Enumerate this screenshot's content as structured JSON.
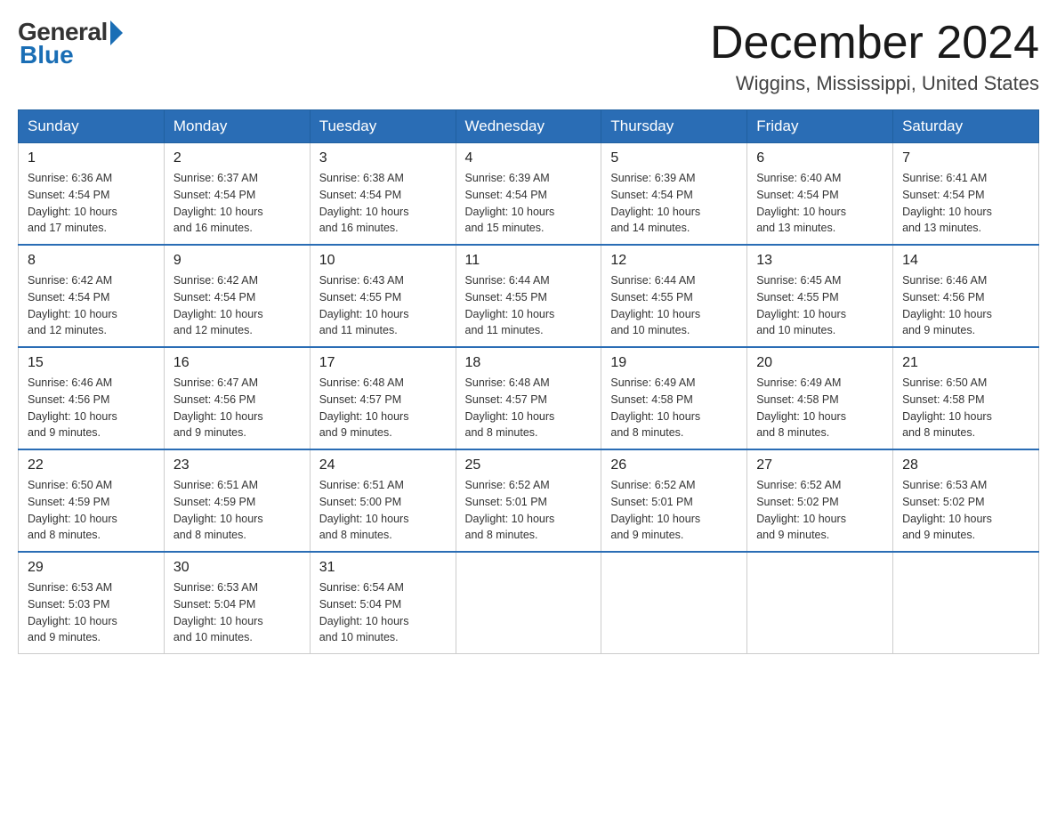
{
  "logo": {
    "general": "General",
    "blue": "Blue"
  },
  "header": {
    "title": "December 2024",
    "location": "Wiggins, Mississippi, United States"
  },
  "weekdays": [
    "Sunday",
    "Monday",
    "Tuesday",
    "Wednesday",
    "Thursday",
    "Friday",
    "Saturday"
  ],
  "weeks": [
    [
      {
        "day": "1",
        "sunrise": "6:36 AM",
        "sunset": "4:54 PM",
        "daylight": "10 hours and 17 minutes."
      },
      {
        "day": "2",
        "sunrise": "6:37 AM",
        "sunset": "4:54 PM",
        "daylight": "10 hours and 16 minutes."
      },
      {
        "day": "3",
        "sunrise": "6:38 AM",
        "sunset": "4:54 PM",
        "daylight": "10 hours and 16 minutes."
      },
      {
        "day": "4",
        "sunrise": "6:39 AM",
        "sunset": "4:54 PM",
        "daylight": "10 hours and 15 minutes."
      },
      {
        "day": "5",
        "sunrise": "6:39 AM",
        "sunset": "4:54 PM",
        "daylight": "10 hours and 14 minutes."
      },
      {
        "day": "6",
        "sunrise": "6:40 AM",
        "sunset": "4:54 PM",
        "daylight": "10 hours and 13 minutes."
      },
      {
        "day": "7",
        "sunrise": "6:41 AM",
        "sunset": "4:54 PM",
        "daylight": "10 hours and 13 minutes."
      }
    ],
    [
      {
        "day": "8",
        "sunrise": "6:42 AM",
        "sunset": "4:54 PM",
        "daylight": "10 hours and 12 minutes."
      },
      {
        "day": "9",
        "sunrise": "6:42 AM",
        "sunset": "4:54 PM",
        "daylight": "10 hours and 12 minutes."
      },
      {
        "day": "10",
        "sunrise": "6:43 AM",
        "sunset": "4:55 PM",
        "daylight": "10 hours and 11 minutes."
      },
      {
        "day": "11",
        "sunrise": "6:44 AM",
        "sunset": "4:55 PM",
        "daylight": "10 hours and 11 minutes."
      },
      {
        "day": "12",
        "sunrise": "6:44 AM",
        "sunset": "4:55 PM",
        "daylight": "10 hours and 10 minutes."
      },
      {
        "day": "13",
        "sunrise": "6:45 AM",
        "sunset": "4:55 PM",
        "daylight": "10 hours and 10 minutes."
      },
      {
        "day": "14",
        "sunrise": "6:46 AM",
        "sunset": "4:56 PM",
        "daylight": "10 hours and 9 minutes."
      }
    ],
    [
      {
        "day": "15",
        "sunrise": "6:46 AM",
        "sunset": "4:56 PM",
        "daylight": "10 hours and 9 minutes."
      },
      {
        "day": "16",
        "sunrise": "6:47 AM",
        "sunset": "4:56 PM",
        "daylight": "10 hours and 9 minutes."
      },
      {
        "day": "17",
        "sunrise": "6:48 AM",
        "sunset": "4:57 PM",
        "daylight": "10 hours and 9 minutes."
      },
      {
        "day": "18",
        "sunrise": "6:48 AM",
        "sunset": "4:57 PM",
        "daylight": "10 hours and 8 minutes."
      },
      {
        "day": "19",
        "sunrise": "6:49 AM",
        "sunset": "4:58 PM",
        "daylight": "10 hours and 8 minutes."
      },
      {
        "day": "20",
        "sunrise": "6:49 AM",
        "sunset": "4:58 PM",
        "daylight": "10 hours and 8 minutes."
      },
      {
        "day": "21",
        "sunrise": "6:50 AM",
        "sunset": "4:58 PM",
        "daylight": "10 hours and 8 minutes."
      }
    ],
    [
      {
        "day": "22",
        "sunrise": "6:50 AM",
        "sunset": "4:59 PM",
        "daylight": "10 hours and 8 minutes."
      },
      {
        "day": "23",
        "sunrise": "6:51 AM",
        "sunset": "4:59 PM",
        "daylight": "10 hours and 8 minutes."
      },
      {
        "day": "24",
        "sunrise": "6:51 AM",
        "sunset": "5:00 PM",
        "daylight": "10 hours and 8 minutes."
      },
      {
        "day": "25",
        "sunrise": "6:52 AM",
        "sunset": "5:01 PM",
        "daylight": "10 hours and 8 minutes."
      },
      {
        "day": "26",
        "sunrise": "6:52 AM",
        "sunset": "5:01 PM",
        "daylight": "10 hours and 9 minutes."
      },
      {
        "day": "27",
        "sunrise": "6:52 AM",
        "sunset": "5:02 PM",
        "daylight": "10 hours and 9 minutes."
      },
      {
        "day": "28",
        "sunrise": "6:53 AM",
        "sunset": "5:02 PM",
        "daylight": "10 hours and 9 minutes."
      }
    ],
    [
      {
        "day": "29",
        "sunrise": "6:53 AM",
        "sunset": "5:03 PM",
        "daylight": "10 hours and 9 minutes."
      },
      {
        "day": "30",
        "sunrise": "6:53 AM",
        "sunset": "5:04 PM",
        "daylight": "10 hours and 10 minutes."
      },
      {
        "day": "31",
        "sunrise": "6:54 AM",
        "sunset": "5:04 PM",
        "daylight": "10 hours and 10 minutes."
      },
      null,
      null,
      null,
      null
    ]
  ],
  "labels": {
    "sunrise": "Sunrise:",
    "sunset": "Sunset:",
    "daylight": "Daylight:"
  }
}
